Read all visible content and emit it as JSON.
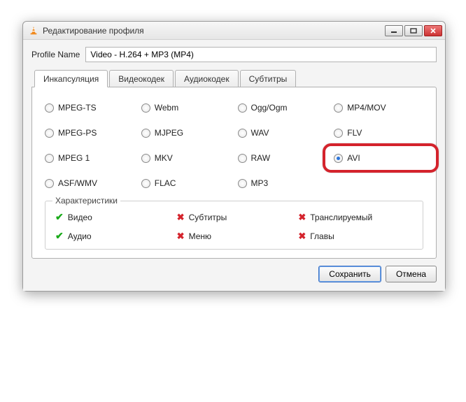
{
  "window": {
    "title": "Редактирование профиля"
  },
  "profile": {
    "label": "Profile Name",
    "value": "Video - H.264 + MP3 (MP4)"
  },
  "tabs": {
    "encapsulation": "Инкапсуляция",
    "videocodec": "Видеокодек",
    "audiocodec": "Аудиокодек",
    "subtitles": "Субтитры"
  },
  "encaps": {
    "options": [
      {
        "id": "mpeg_ts",
        "label": "MPEG-TS",
        "checked": false
      },
      {
        "id": "webm",
        "label": "Webm",
        "checked": false
      },
      {
        "id": "ogg",
        "label": "Ogg/Ogm",
        "checked": false
      },
      {
        "id": "mp4",
        "label": "MP4/MOV",
        "checked": false
      },
      {
        "id": "mpeg_ps",
        "label": "MPEG-PS",
        "checked": false
      },
      {
        "id": "mjpeg",
        "label": "MJPEG",
        "checked": false
      },
      {
        "id": "wav",
        "label": "WAV",
        "checked": false
      },
      {
        "id": "flv",
        "label": "FLV",
        "checked": false
      },
      {
        "id": "mpeg1",
        "label": "MPEG 1",
        "checked": false
      },
      {
        "id": "mkv",
        "label": "MKV",
        "checked": false
      },
      {
        "id": "raw",
        "label": "RAW",
        "checked": false
      },
      {
        "id": "avi",
        "label": "AVI",
        "checked": true
      },
      {
        "id": "asf",
        "label": "ASF/WMV",
        "checked": false
      },
      {
        "id": "flac",
        "label": "FLAC",
        "checked": false
      },
      {
        "id": "mp3",
        "label": "MP3",
        "checked": false
      }
    ]
  },
  "characteristics": {
    "legend": "Характеристики",
    "items": [
      {
        "id": "video",
        "label": "Видео",
        "ok": true
      },
      {
        "id": "subs",
        "label": "Субтитры",
        "ok": false
      },
      {
        "id": "stream",
        "label": "Транслируемый",
        "ok": false
      },
      {
        "id": "audio",
        "label": "Аудио",
        "ok": true
      },
      {
        "id": "menu",
        "label": "Меню",
        "ok": false
      },
      {
        "id": "chapters",
        "label": "Главы",
        "ok": false
      }
    ]
  },
  "buttons": {
    "save": "Сохранить",
    "cancel": "Отмена"
  },
  "highlight_target": "avi"
}
